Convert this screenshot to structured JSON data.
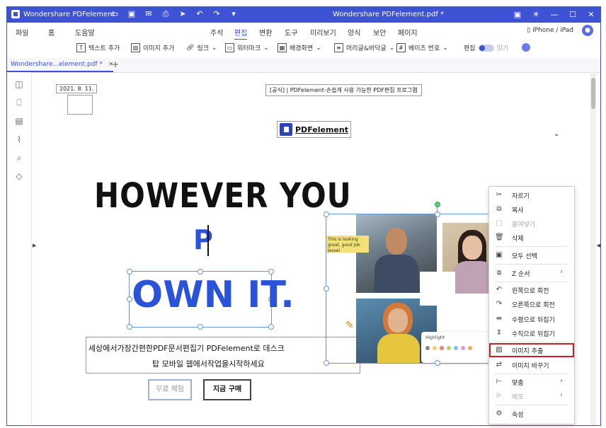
{
  "app": {
    "name": "Wondershare PDFelement",
    "window_title": "Wondershare PDFelement.pdf *"
  },
  "menu": {
    "file": "파일",
    "home": "홈",
    "help": "도움말",
    "annotate": "주석",
    "edit": "편집",
    "convert": "변환",
    "tools": "도구",
    "preview": "미리보기",
    "form": "양식",
    "protect": "보안",
    "page": "페이지",
    "device": "iPhone / iPad"
  },
  "toolbar": {
    "add_text": "텍스트 추가",
    "add_image": "이미지 추가",
    "link": "링크",
    "watermark": "워터마크",
    "background": "배경화면",
    "header_footer": "머리글&바닥글",
    "bates": "베이츠 번호",
    "edit_label": "편집",
    "read_label": "읽기"
  },
  "tab": {
    "title": "Wondershare...element.pdf *",
    "close": "×",
    "add": "+"
  },
  "document": {
    "date": "2021. 8. 11.",
    "headline": "[공식] | PDFelement-손쉽게 사용 가능한 PDF편집 프로그램",
    "logo_text": "PDFelement",
    "however": "HOWEVER YOU",
    "p": "P",
    "ownit": "OWN IT.",
    "korean1": "세상에서가장간편한PDF문서편집기  PDFelement로 데스크",
    "korean2": "탑  모바일  웹에서작업을시작하세요",
    "btn_free": "무료 체험",
    "btn_buy": "지금 구매",
    "note": "This is looking great, good job Jesse!",
    "highlight": "Highlight"
  },
  "context_menu": {
    "items": [
      {
        "label": "자르기",
        "icon": "scissors-icon",
        "disabled": false
      },
      {
        "label": "복사",
        "icon": "copy-icon",
        "disabled": false
      },
      {
        "label": "붙여넣기",
        "icon": "paste-icon",
        "disabled": true
      },
      {
        "label": "삭제",
        "icon": "trash-icon",
        "disabled": false
      },
      {
        "label": "모두 선택",
        "icon": "select-all-icon",
        "disabled": false
      },
      {
        "label": "Z 순서",
        "icon": "z-order-icon",
        "disabled": false,
        "submenu": true
      },
      {
        "label": "왼쪽으로 회전",
        "icon": "rotate-left-icon",
        "disabled": false
      },
      {
        "label": "오른쪽으로 회전",
        "icon": "rotate-right-icon",
        "disabled": false
      },
      {
        "label": "수평으로 뒤집기",
        "icon": "flip-horizontal-icon",
        "disabled": false
      },
      {
        "label": "수직으로 뒤집기",
        "icon": "flip-vertical-icon",
        "disabled": false
      },
      {
        "label": "이미지 추출",
        "icon": "extract-image-icon",
        "disabled": false,
        "highlighted": true
      },
      {
        "label": "이미지 바꾸기",
        "icon": "replace-image-icon",
        "disabled": false
      },
      {
        "label": "맞춤",
        "icon": "align-icon",
        "disabled": false,
        "submenu": true
      },
      {
        "label": "배포",
        "icon": "distribute-icon",
        "disabled": true,
        "submenu": true
      },
      {
        "label": "속성",
        "icon": "properties-icon",
        "disabled": false
      }
    ]
  },
  "colors": {
    "accent": "#3d52d5",
    "highlight_border": "#c81f2a",
    "text_blue": "#2a53d9"
  }
}
